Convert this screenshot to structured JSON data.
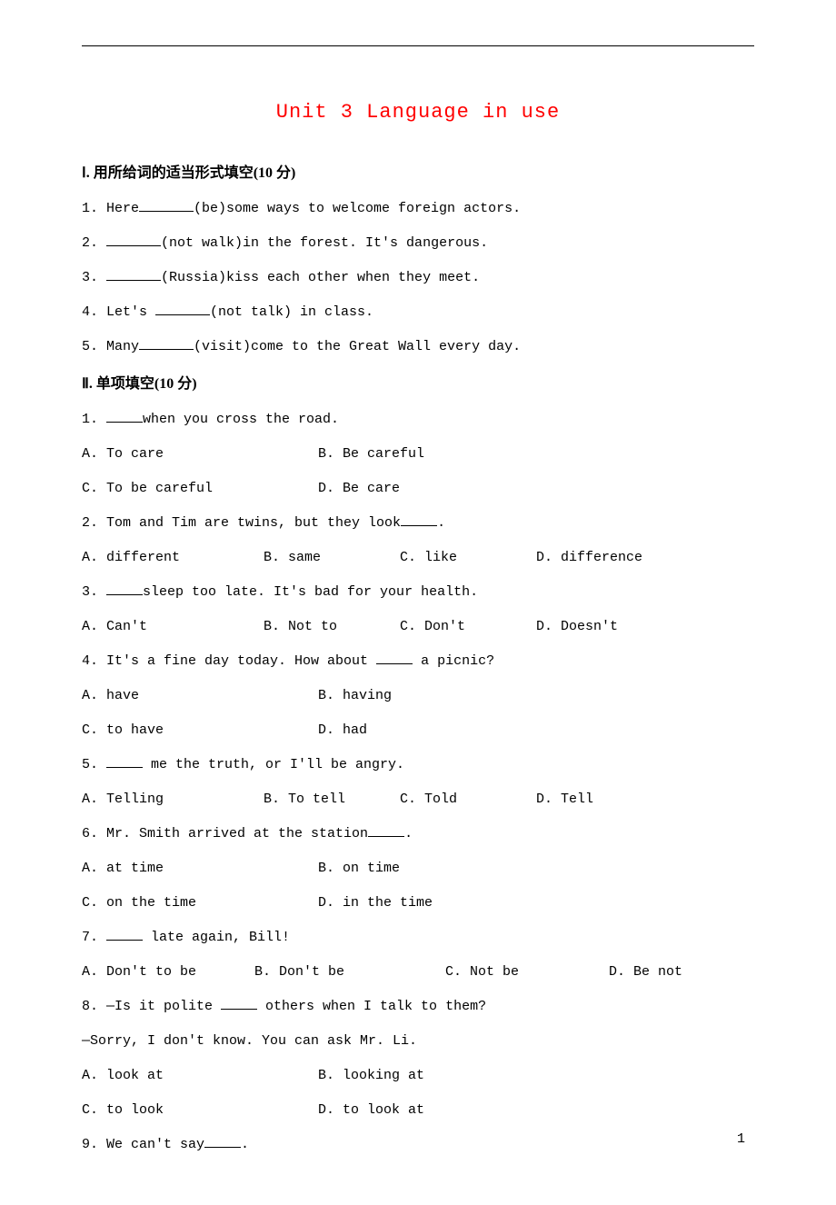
{
  "title": "Unit 3 Language in use",
  "section1": {
    "heading": "Ⅰ. 用所给词的适当形式填空(10 分)",
    "items": [
      {
        "pre": "1. Here",
        "hint": "(be)some ways to welcome foreign actors."
      },
      {
        "pre": "2. ",
        "hint": "(not walk)in the forest. It's dangerous."
      },
      {
        "pre": "3. ",
        "hint": "(Russia)kiss each other when they meet."
      },
      {
        "pre": "4. Let's ",
        "hint": "(not talk) in class."
      },
      {
        "pre": "5. Many",
        "hint": "(visit)come to the Great Wall every day."
      }
    ]
  },
  "section2": {
    "heading": "Ⅱ. 单项填空(10 分)",
    "questions": [
      {
        "q_pre": "1. ",
        "q_post": "when you cross the road.",
        "layout": "two-col",
        "opts": [
          "A. To care",
          "B. Be careful",
          "C. To be careful",
          "D. Be care"
        ]
      },
      {
        "q_pre": "2. Tom and Tim are twins, but they look",
        "q_post": ".",
        "layout": "four-col",
        "opts": [
          "A. different",
          "B. same",
          "C. like",
          "D. difference"
        ]
      },
      {
        "q_pre": "3. ",
        "q_post": "sleep too late. It's bad for your health.",
        "layout": "four-col",
        "opts": [
          "A. Can't",
          "B. Not to",
          "C. Don't",
          "D. Doesn't"
        ]
      },
      {
        "q_pre": "4. It's a fine day today. How about ",
        "q_post": " a picnic?",
        "layout": "two-col",
        "opts": [
          "A. have",
          "B. having",
          "C. to have",
          "D. had"
        ]
      },
      {
        "q_pre": "5. ",
        "q_post": " me the truth, or I'll be angry.",
        "layout": "four-col",
        "opts": [
          "A. Telling",
          "B. To tell",
          "C. Told",
          "D. Tell"
        ]
      },
      {
        "q_pre": "6. Mr. Smith arrived at the station",
        "q_post": ".",
        "layout": "two-col",
        "opts": [
          "A. at time",
          "B. on time",
          "C. on the time",
          "D. in the time"
        ]
      },
      {
        "q_pre": "7. ",
        "q_post": " late again, Bill!",
        "layout": "four-col-wide",
        "opts": [
          "A. Don't to be",
          "B. Don't be",
          "C. Not be",
          "D. Be not"
        ]
      },
      {
        "q_pre": "8. —Is it polite ",
        "q_post": " others when I talk to them?",
        "line2": "—Sorry, I don't know. You can ask Mr. Li.",
        "layout": "two-col",
        "opts": [
          "A. look at",
          "B. looking at",
          "C. to look",
          "D. to look at"
        ]
      },
      {
        "q_pre": "9. We can't say",
        "q_post": ".",
        "layout": "none",
        "opts": []
      }
    ]
  },
  "pageNumber": "1"
}
